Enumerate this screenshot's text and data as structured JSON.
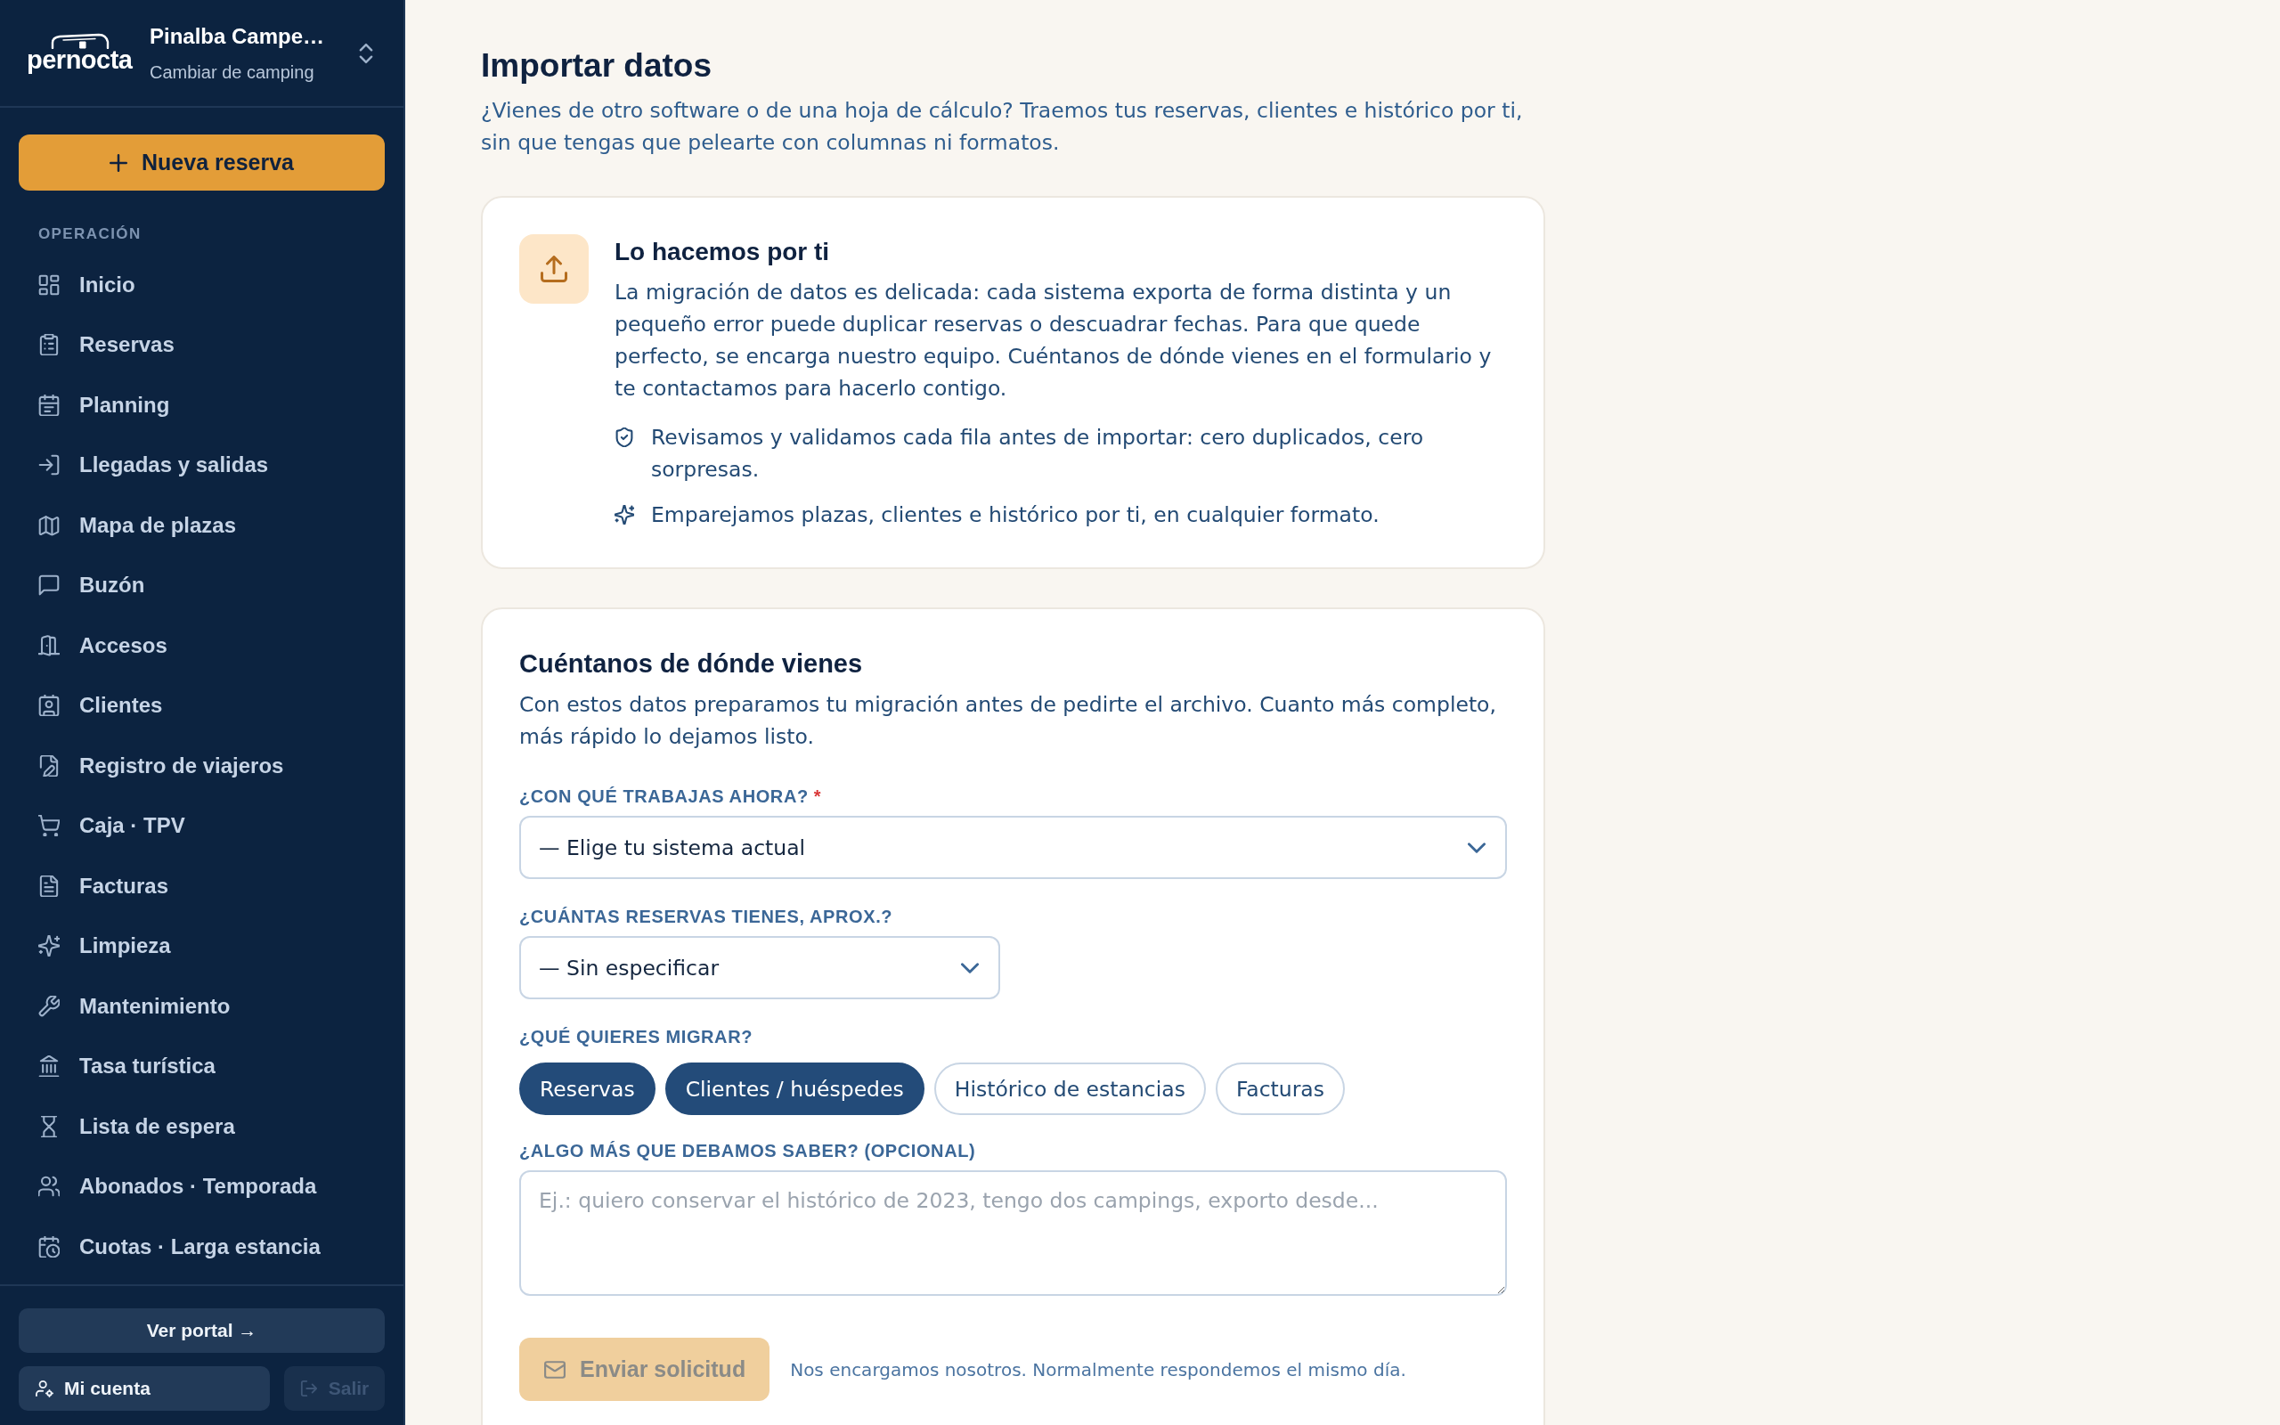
{
  "sidebar": {
    "brand": "pernocta",
    "camp": {
      "name": "Pinalba Campe…",
      "action": "Cambiar de camping"
    },
    "new_button": "Nueva reserva",
    "section": "OPERACIÓN",
    "items": [
      {
        "label": "Inicio",
        "selected": false
      },
      {
        "label": "Reservas",
        "selected": false
      },
      {
        "label": "Planning",
        "selected": false
      },
      {
        "label": "Llegadas y salidas",
        "selected": false
      },
      {
        "label": "Mapa de plazas",
        "selected": false
      },
      {
        "label": "Buzón",
        "selected": false
      },
      {
        "label": "Accesos",
        "selected": false
      },
      {
        "label": "Clientes",
        "selected": false
      },
      {
        "label": "Registro de viajeros",
        "selected": false
      },
      {
        "label": "Caja · TPV",
        "selected": false
      },
      {
        "label": "Facturas",
        "selected": false
      },
      {
        "label": "Limpieza",
        "selected": false
      },
      {
        "label": "Mantenimiento",
        "selected": false
      },
      {
        "label": "Tasa turística",
        "selected": false
      },
      {
        "label": "Lista de espera",
        "selected": false
      },
      {
        "label": "Abonados · Temporada",
        "selected": false
      },
      {
        "label": "Cuotas · Larga estancia",
        "selected": false
      }
    ],
    "footer_buttons": [
      {
        "label": "Ver portal →",
        "disabled": false
      },
      {
        "label": "Mi cuenta",
        "disabled": false
      },
      {
        "label": "Salir",
        "disabled": true
      }
    ]
  },
  "page": {
    "title": "Importar datos",
    "subtitle": "¿Vienes de otro software o de una hoja de cálculo? Traemos tus reservas, clientes e histórico por ti, sin que tengas que pelearte con columnas ni formatos."
  },
  "info_card": {
    "title": "Lo hacemos por ti",
    "text": "La migración de datos es delicada: cada sistema exporta de forma distinta y un pequeño error puede duplicar reservas o descuadrar fechas. Para que quede perfecto, se encarga nuestro equipo. Cuéntanos de dónde vienes en el formulario y te contactamos para hacerlo contigo.",
    "bullets": [
      "Revisamos y validamos cada fila antes de importar: cero duplicados, cero sorpresas.",
      "Emparejamos plazas, clientes e histórico por ti, en cualquier formato."
    ]
  },
  "form": {
    "title": "Cuéntanos de dónde vienes",
    "text": "Con estos datos preparamos tu migración antes de pedirte el archivo. Cuanto más completo, más rápido lo dejamos listo.",
    "fields": [
      {
        "kind": "select",
        "label": "¿CON QUÉ TRABAJAS AHORA?",
        "required_mark": "*",
        "value": "— Elige tu sistema actual"
      },
      {
        "kind": "select",
        "label": "¿CUÁNTAS RESERVAS TIENES, APROX.?",
        "value": "— Sin especificar"
      },
      {
        "kind": "chips",
        "label": "¿QUÉ QUIERES MIGRAR?",
        "options": [
          {
            "label": "Reservas",
            "selected": true
          },
          {
            "label": "Clientes / huéspedes",
            "selected": true
          },
          {
            "label": "Histórico de estancias",
            "selected": false
          },
          {
            "label": "Facturas",
            "selected": false
          }
        ]
      },
      {
        "kind": "textarea",
        "label": "¿ALGO MÁS QUE DEBAMOS SABER? (OPCIONAL)",
        "placeholder": "Ej.: quiero conservar el histórico de 2023, tengo dos campings, exporto desde..."
      }
    ],
    "submit": {
      "label": "Enviar solicitud",
      "disabled": true
    },
    "note": "Nos encargamos nosotros. Normalmente respondemos el mismo día."
  }
}
